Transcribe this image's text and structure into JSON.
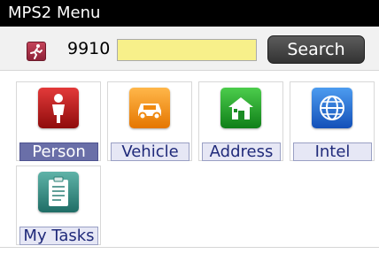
{
  "window": {
    "title": "MPS2 Menu"
  },
  "toolbar": {
    "case_number": "9910",
    "search_value": "",
    "search_label": "Search"
  },
  "menu": {
    "items": [
      {
        "label": "Person",
        "icon": "person-icon",
        "selected": true
      },
      {
        "label": "Vehicle",
        "icon": "vehicle-icon"
      },
      {
        "label": "Address",
        "icon": "house-icon"
      },
      {
        "label": "Intel",
        "icon": "globe-icon"
      },
      {
        "label": "My Tasks",
        "icon": "clipboard-icon"
      }
    ]
  },
  "colors": {
    "title_bar": "#000000",
    "search_field": "#f7f08a",
    "selected_label": "#6a6fa8"
  }
}
